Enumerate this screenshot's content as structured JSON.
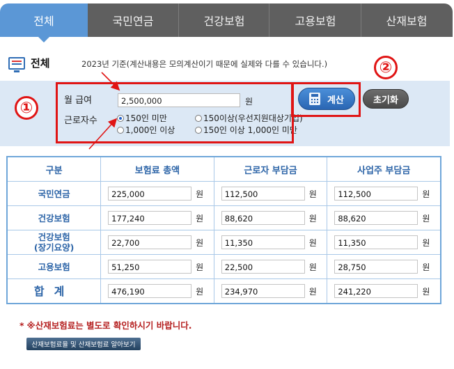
{
  "tabs": [
    {
      "label": "전체",
      "active": true
    },
    {
      "label": "국민연금",
      "active": false
    },
    {
      "label": "건강보험",
      "active": false
    },
    {
      "label": "고용보험",
      "active": false
    },
    {
      "label": "산재보험",
      "active": false
    }
  ],
  "heading": {
    "title": "전체",
    "icon": "monitor-icon"
  },
  "notice": "2023년 기준(계산내용은 모의계산이기 때문에 실제와 다를 수 있습니다.)",
  "form": {
    "salary_label": "월 급여",
    "salary_value": "2,500,000",
    "salary_unit": "원",
    "workers_label": "근로자수",
    "options": [
      {
        "label": "150인 미만",
        "selected": true
      },
      {
        "label": "150이상(우선지원대상기업)",
        "selected": false
      },
      {
        "label": "1,000인 이상",
        "selected": false
      },
      {
        "label": "150인 이상 1,000인 미만",
        "selected": false
      }
    ],
    "calc_label": "계산",
    "reset_label": "초기화"
  },
  "annotations": {
    "one": "①",
    "two": "②"
  },
  "table": {
    "headers": [
      "구분",
      "보험료 총액",
      "근로자 부담금",
      "사업주 부담금"
    ],
    "unit": "원",
    "rows": [
      {
        "label": "국민연금",
        "total": "225,000",
        "employee": "112,500",
        "employer": "112,500"
      },
      {
        "label": "건강보험",
        "total": "177,240",
        "employee": "88,620",
        "employer": "88,620"
      },
      {
        "label": "건강보험\n(장기요양)",
        "label1": "건강보험",
        "label2": "(장기요양)",
        "total": "22,700",
        "employee": "11,350",
        "employer": "11,350"
      },
      {
        "label": "고용보험",
        "total": "51,250",
        "employee": "22,500",
        "employer": "28,750"
      },
      {
        "label": "합계",
        "total": "476,190",
        "employee": "234,970",
        "employer": "241,220"
      }
    ]
  },
  "footer": {
    "note": "※산재보험료는 별도로 확인하시기 바랍니다.",
    "note_star": "*",
    "link_label": "산재보험료율 및 산재보험료 알아보기"
  },
  "colors": {
    "accent": "#5b97d6",
    "annotation": "#e01414",
    "tab_bg": "#5f5f5f",
    "panel": "#dce8f5"
  }
}
